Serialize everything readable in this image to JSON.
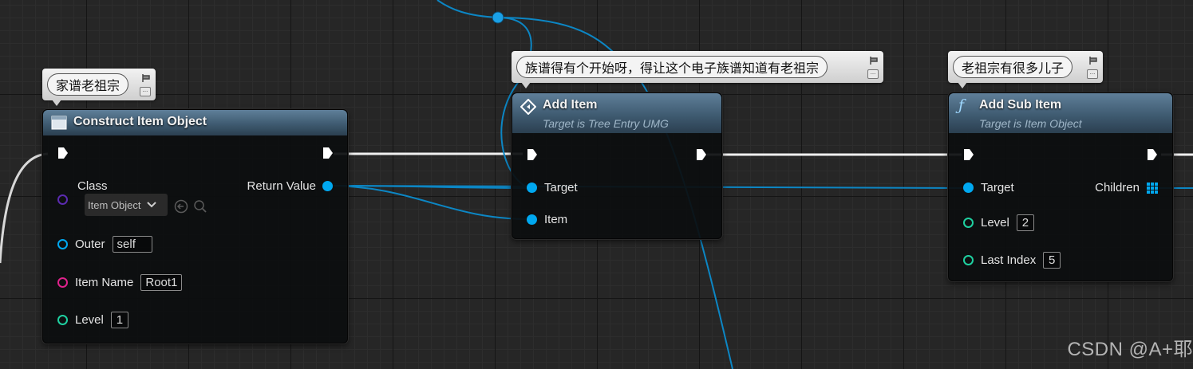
{
  "colors": {
    "exec_wire": "#ffffff",
    "object_pin": "#00a8f0",
    "class_pin": "#5b2bb0",
    "string_pin": "#e0228c",
    "integer_pin": "#1fd0a0",
    "header_top": "#5f7f99",
    "comment_bg": "#e6e6e6"
  },
  "comments": [
    {
      "text": "家谱老祖宗"
    },
    {
      "text": "族谱得有个开始呀，得让这个电子族谱知道有老祖宗"
    },
    {
      "text": "老祖宗有很多儿子"
    }
  ],
  "nodes": {
    "construct": {
      "icon": "construct-object-icon",
      "title": "Construct Item Object",
      "class_label": "Class",
      "class_value": "Item Object",
      "return_label": "Return Value",
      "outer_label": "Outer",
      "outer_value": "self",
      "item_name_label": "Item Name",
      "item_name_value": "Root1",
      "level_label": "Level",
      "level_value": "1"
    },
    "add_item": {
      "icon": "event-diamond-icon",
      "title": "Add Item",
      "subtitle": "Target is Tree Entry UMG",
      "target_label": "Target",
      "item_label": "Item"
    },
    "add_sub_item": {
      "icon": "function-icon",
      "icon_glyph": "ƒ",
      "title": "Add Sub Item",
      "subtitle": "Target is Item Object",
      "target_label": "Target",
      "children_label": "Children",
      "level_label": "Level",
      "level_value": "2",
      "last_index_label": "Last Index",
      "last_index_value": "5"
    }
  },
  "watermark": "CSDN @A+耶"
}
